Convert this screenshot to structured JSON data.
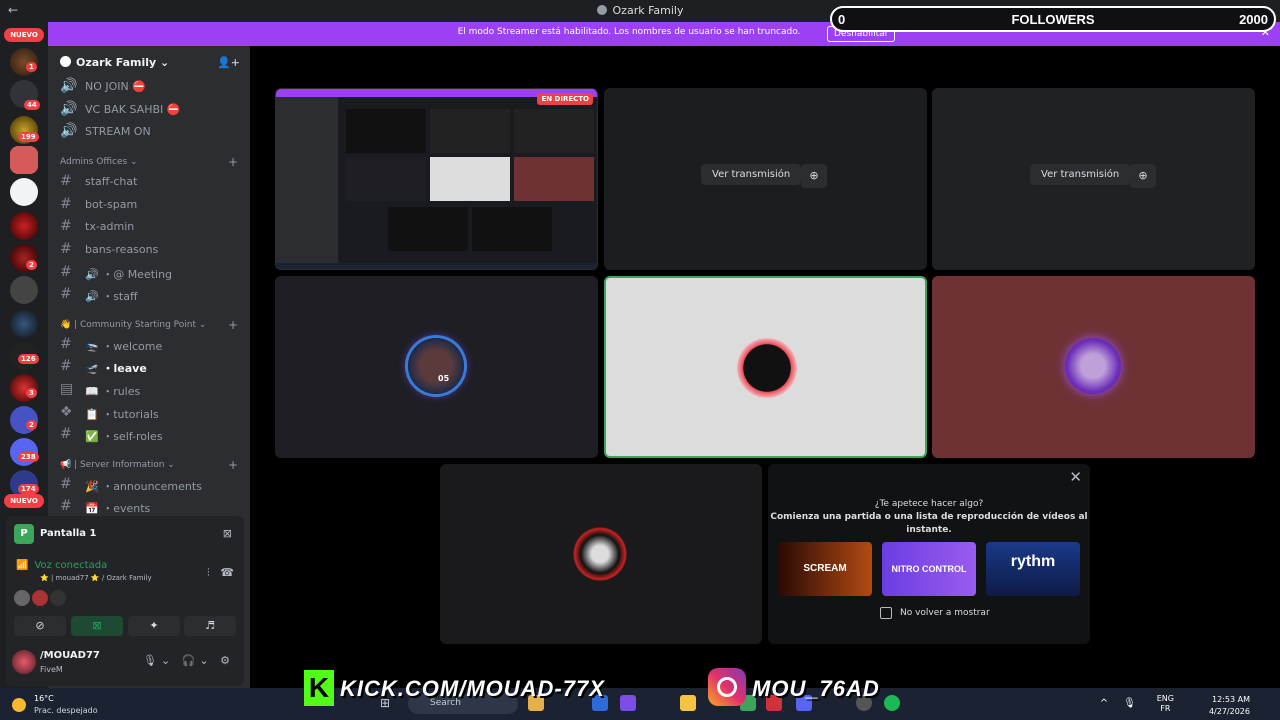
{
  "window": {
    "title": "Ozark Family",
    "back": "←"
  },
  "followers_widget": {
    "current": "0",
    "label": "FOLLOWERS",
    "goal": "2000"
  },
  "streamer_bar": {
    "message": "El modo Streamer está habilitado. Los nombres de usuario se han truncado.",
    "button": "Deshabilitar",
    "close": "✕"
  },
  "server_rail": {
    "new_badge_top": "NUEVO",
    "new_badge_bottom": "NUEVO",
    "counts": [
      "1",
      "44",
      "199",
      "2",
      "126",
      "3",
      "2",
      "238",
      "174"
    ]
  },
  "sidebar": {
    "guild_name": "Ozark Family ⌄",
    "channels_top": [
      {
        "name": "NO JOIN ⛔"
      },
      {
        "name": "VC BAK SAHBI ⛔"
      },
      {
        "name": "STREAM ON"
      }
    ],
    "cat_admins": "Admins Offices ⌄",
    "admins_channels": [
      {
        "name": "staff-chat"
      },
      {
        "name": "bot-spam"
      },
      {
        "name": "tx-admin"
      },
      {
        "name": "bans-reasons"
      },
      {
        "name": "🔊 ・@ Meeting"
      },
      {
        "name": "🔊 ・staff"
      }
    ],
    "cat_community": "👋 | Community Starting Point ⌄",
    "community_channels": [
      {
        "name": "🛬 ・welcome"
      },
      {
        "name": "🛫 ・leave"
      },
      {
        "name": "📖 ・rules"
      },
      {
        "name": "📋 ・tutorials"
      },
      {
        "name": "✅ ・self-roles"
      }
    ],
    "cat_server_info": "📢 | Server Information ⌄",
    "info_channels": [
      {
        "name": "🎉 ・announcements"
      },
      {
        "name": "📅 ・events"
      }
    ]
  },
  "voice_panel": {
    "screen_label": "Pantalla 1",
    "status": "Voz conectada",
    "sub": "⭐ | mouad77 ⭐ / Ozark Family",
    "user_name": "/MOUAD77",
    "user_game": "FiveM"
  },
  "stage": {
    "live_badge": "EN DIRECTO",
    "watch_label": "Ver transmisión",
    "watch_label_2": "Ver transmisión",
    "avatar_number": "05"
  },
  "activity": {
    "question": "¿Te apetece hacer algo?",
    "subtitle": "Comienza una partida o una lista de reproducción de vídeos al instante.",
    "cards": [
      "SCREAM",
      "NITRO CONTROL",
      "rythm"
    ],
    "dont_show": "No volver a mostrar"
  },
  "taskbar": {
    "temp": "16°C",
    "condition": "Prac. despejado",
    "search": "Search",
    "lang_1": "ENG",
    "lang_2": "FR",
    "time": "12:53 AM",
    "date": "4/27/2026"
  },
  "overlay": {
    "kick_letter": "K",
    "kick": "KICK.COM/MOUAD-77X",
    "instagram": "MOU_76AD"
  },
  "colors": {
    "accent": "#9b41f3",
    "live": "#ed4245",
    "kick": "#53fc18",
    "voice": "#23a55a"
  }
}
